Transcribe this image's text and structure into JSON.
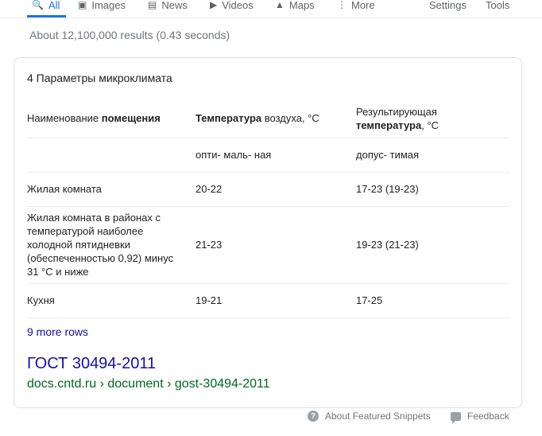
{
  "nav": {
    "tabs": [
      {
        "label": "All",
        "icon": "search-icon"
      },
      {
        "label": "Images",
        "icon": "image-icon"
      },
      {
        "label": "News",
        "icon": "news-icon"
      },
      {
        "label": "Videos",
        "icon": "video-icon"
      },
      {
        "label": "Maps",
        "icon": "map-icon"
      },
      {
        "label": "More",
        "icon": "more-vertical-icon"
      }
    ],
    "settings_label": "Settings",
    "tools_label": "Tools",
    "active_tab": "All"
  },
  "result_stats": "About 12,100,000 results (0.43 seconds)",
  "snippet": {
    "title": "4 Параметры микроклимата",
    "header": {
      "col1_plain": "Наименование ",
      "col1_bold": "помещения",
      "col2_bold": "Температура",
      "col2_plain": " воздуха, °С",
      "col3_plain": "Результирующая",
      "col3_bold": "температура",
      "col3_tail": ", °С"
    },
    "subheader": {
      "col2": "опти- маль- ная",
      "col3": "допус- тимая"
    },
    "rows": [
      {
        "room": "Жилая комната",
        "optimal": "20-22",
        "allowed": "17-23 (19-23)"
      },
      {
        "room": "Жилая комната в районах с температурой наиболее холодной пятидневки (обеспеченностью 0,92) минус 31 °С и ниже",
        "optimal": "21-23",
        "allowed": "19-23 (21-23)"
      },
      {
        "room": "Кухня",
        "optimal": "19-21",
        "allowed": "17-25"
      }
    ],
    "more_rows_label": "9 more rows",
    "source_title": "ГОСТ 30494-2011",
    "source_url": "docs.cntd.ru › document › gost-30494-2011"
  },
  "footer": {
    "about_label": "About Featured Snippets",
    "feedback_label": "Feedback"
  },
  "colors": {
    "link": "#1a0dab",
    "url_green": "#006621",
    "active_tab": "#1a73e8",
    "muted": "#70757a"
  }
}
